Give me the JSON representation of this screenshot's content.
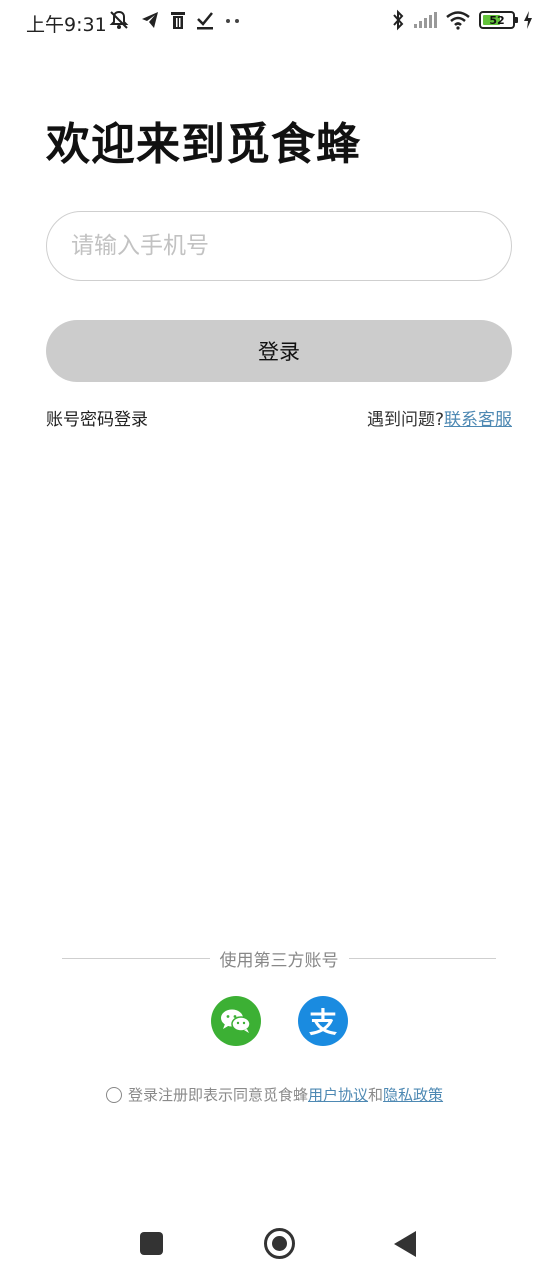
{
  "status_bar": {
    "time": "上午9:31",
    "left_icons": [
      "bell-off-icon",
      "telegram-icon",
      "trash-icon",
      "download-check-icon",
      "more-dots-icon"
    ],
    "right_icons": [
      "bluetooth-icon",
      "signal-icon",
      "wifi-icon",
      "charging-icon"
    ],
    "battery_level": "52"
  },
  "page": {
    "title": "欢迎来到觅食蜂"
  },
  "phone_input": {
    "placeholder": "请输入手机号",
    "value": ""
  },
  "login_button_label": "登录",
  "links": {
    "password_login": "账号密码登录",
    "help_prefix": "遇到问题?",
    "contact_support": "联系客服"
  },
  "third_party": {
    "divider_text": "使用第三方账号",
    "providers": [
      "wechat",
      "alipay"
    ],
    "alipay_glyph": "支"
  },
  "agreement": {
    "prefix": "登录注册即表示同意觅食蜂",
    "user_agreement": "用户协议",
    "joiner": "和",
    "privacy_policy": "隐私政策",
    "checked": false
  },
  "colors": {
    "button_bg": "#cccccc",
    "link": "#4e89b3",
    "wechat": "#3cb034",
    "alipay": "#1a8be0",
    "battery_fill": "#62c23a"
  }
}
